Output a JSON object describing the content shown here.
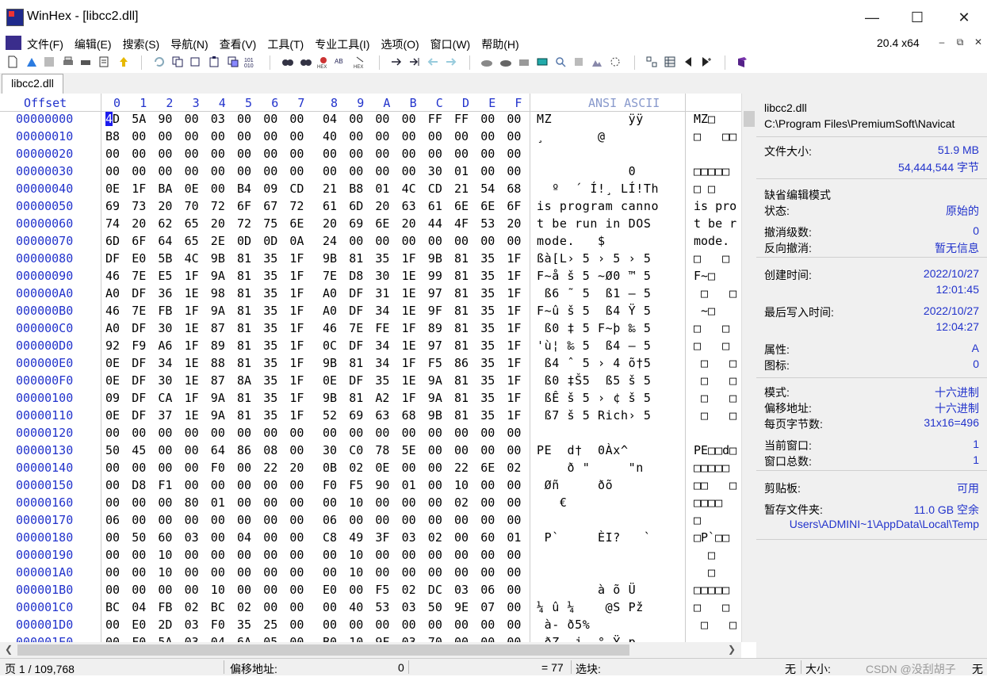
{
  "window": {
    "title": "WinHex - [libcc2.dll]",
    "minimize_icon": "minimize-icon",
    "maximize_icon": "maximize-icon",
    "close_icon": "close-icon"
  },
  "menu": {
    "items": [
      "文件(F)",
      "编辑(E)",
      "搜索(S)",
      "导航(N)",
      "查看(V)",
      "工具(T)",
      "专业工具(I)",
      "选项(O)",
      "窗口(W)",
      "帮助(H)"
    ],
    "version": "20.4 x64"
  },
  "tab": {
    "label": "libcc2.dll"
  },
  "hex": {
    "offset_header": "Offset",
    "col_headers": [
      "0",
      "1",
      "2",
      "3",
      "4",
      "5",
      "6",
      "7",
      "8",
      "9",
      "A",
      "B",
      "C",
      "D",
      "E",
      "F"
    ],
    "text_header": "ANSI ASCII",
    "rows": [
      {
        "off": "00000000",
        "bytes": [
          "4D",
          "5A",
          "90",
          "00",
          "03",
          "00",
          "00",
          "00",
          "04",
          "00",
          "00",
          "00",
          "FF",
          "FF",
          "00",
          "00"
        ],
        "ansi": "MZ          ÿÿ",
        "ascii": "MZ□"
      },
      {
        "off": "00000010",
        "bytes": [
          "B8",
          "00",
          "00",
          "00",
          "00",
          "00",
          "00",
          "00",
          "40",
          "00",
          "00",
          "00",
          "00",
          "00",
          "00",
          "00"
        ],
        "ansi": "¸       @",
        "ascii": "□   □□"
      },
      {
        "off": "00000020",
        "bytes": [
          "00",
          "00",
          "00",
          "00",
          "00",
          "00",
          "00",
          "00",
          "00",
          "00",
          "00",
          "00",
          "00",
          "00",
          "00",
          "00"
        ],
        "ansi": "",
        "ascii": ""
      },
      {
        "off": "00000030",
        "bytes": [
          "00",
          "00",
          "00",
          "00",
          "00",
          "00",
          "00",
          "00",
          "00",
          "00",
          "00",
          "00",
          "30",
          "01",
          "00",
          "00"
        ],
        "ansi": "            0",
        "ascii": "□□□□□"
      },
      {
        "off": "00000040",
        "bytes": [
          "0E",
          "1F",
          "BA",
          "0E",
          "00",
          "B4",
          "09",
          "CD",
          "21",
          "B8",
          "01",
          "4C",
          "CD",
          "21",
          "54",
          "68"
        ],
        "ansi": "  º  ´ Í!¸ LÍ!Th",
        "ascii": "□ □"
      },
      {
        "off": "00000050",
        "bytes": [
          "69",
          "73",
          "20",
          "70",
          "72",
          "6F",
          "67",
          "72",
          "61",
          "6D",
          "20",
          "63",
          "61",
          "6E",
          "6E",
          "6F"
        ],
        "ansi": "is program canno",
        "ascii": "is pro"
      },
      {
        "off": "00000060",
        "bytes": [
          "74",
          "20",
          "62",
          "65",
          "20",
          "72",
          "75",
          "6E",
          "20",
          "69",
          "6E",
          "20",
          "44",
          "4F",
          "53",
          "20"
        ],
        "ansi": "t be run in DOS ",
        "ascii": "t be r"
      },
      {
        "off": "00000070",
        "bytes": [
          "6D",
          "6F",
          "64",
          "65",
          "2E",
          "0D",
          "0D",
          "0A",
          "24",
          "00",
          "00",
          "00",
          "00",
          "00",
          "00",
          "00"
        ],
        "ansi": "mode.   $",
        "ascii": "mode."
      },
      {
        "off": "00000080",
        "bytes": [
          "DF",
          "E0",
          "5B",
          "4C",
          "9B",
          "81",
          "35",
          "1F",
          "9B",
          "81",
          "35",
          "1F",
          "9B",
          "81",
          "35",
          "1F"
        ],
        "ansi": "ßà[L› 5 › 5 › 5",
        "ascii": "□   □"
      },
      {
        "off": "00000090",
        "bytes": [
          "46",
          "7E",
          "E5",
          "1F",
          "9A",
          "81",
          "35",
          "1F",
          "7E",
          "D8",
          "30",
          "1E",
          "99",
          "81",
          "35",
          "1F"
        ],
        "ansi": "F~å š 5 ~Ø0 ™ 5",
        "ascii": "F~□"
      },
      {
        "off": "000000A0",
        "bytes": [
          "A0",
          "DF",
          "36",
          "1E",
          "98",
          "81",
          "35",
          "1F",
          "A0",
          "DF",
          "31",
          "1E",
          "97",
          "81",
          "35",
          "1F"
        ],
        "ansi": " ß6 ˜ 5  ß1 — 5",
        "ascii": " □   □"
      },
      {
        "off": "000000B0",
        "bytes": [
          "46",
          "7E",
          "FB",
          "1F",
          "9A",
          "81",
          "35",
          "1F",
          "A0",
          "DF",
          "34",
          "1E",
          "9F",
          "81",
          "35",
          "1F"
        ],
        "ansi": "F~û š 5  ß4 Ÿ 5",
        "ascii": " ~□"
      },
      {
        "off": "000000C0",
        "bytes": [
          "A0",
          "DF",
          "30",
          "1E",
          "87",
          "81",
          "35",
          "1F",
          "46",
          "7E",
          "FE",
          "1F",
          "89",
          "81",
          "35",
          "1F"
        ],
        "ansi": " ß0 ‡ 5 F~þ ‰ 5",
        "ascii": "□   □"
      },
      {
        "off": "000000D0",
        "bytes": [
          "92",
          "F9",
          "A6",
          "1F",
          "89",
          "81",
          "35",
          "1F",
          "0C",
          "DF",
          "34",
          "1E",
          "97",
          "81",
          "35",
          "1F"
        ],
        "ansi": "'ù¦ ‰ 5  ß4 — 5",
        "ascii": "□   □"
      },
      {
        "off": "000000E0",
        "bytes": [
          "0E",
          "DF",
          "34",
          "1E",
          "88",
          "81",
          "35",
          "1F",
          "9B",
          "81",
          "34",
          "1F",
          "F5",
          "86",
          "35",
          "1F"
        ],
        "ansi": " ß4 ˆ 5 › 4 õ†5",
        "ascii": " □   □"
      },
      {
        "off": "000000F0",
        "bytes": [
          "0E",
          "DF",
          "30",
          "1E",
          "87",
          "8A",
          "35",
          "1F",
          "0E",
          "DF",
          "35",
          "1E",
          "9A",
          "81",
          "35",
          "1F"
        ],
        "ansi": " ß0 ‡Š5  ß5 š 5",
        "ascii": " □   □"
      },
      {
        "off": "00000100",
        "bytes": [
          "09",
          "DF",
          "CA",
          "1F",
          "9A",
          "81",
          "35",
          "1F",
          "9B",
          "81",
          "A2",
          "1F",
          "9A",
          "81",
          "35",
          "1F"
        ],
        "ansi": " ßÊ š 5 › ¢ š 5",
        "ascii": " □   □"
      },
      {
        "off": "00000110",
        "bytes": [
          "0E",
          "DF",
          "37",
          "1E",
          "9A",
          "81",
          "35",
          "1F",
          "52",
          "69",
          "63",
          "68",
          "9B",
          "81",
          "35",
          "1F"
        ],
        "ansi": " ß7 š 5 Rich› 5",
        "ascii": " □   □"
      },
      {
        "off": "00000120",
        "bytes": [
          "00",
          "00",
          "00",
          "00",
          "00",
          "00",
          "00",
          "00",
          "00",
          "00",
          "00",
          "00",
          "00",
          "00",
          "00",
          "00"
        ],
        "ansi": "",
        "ascii": ""
      },
      {
        "off": "00000130",
        "bytes": [
          "50",
          "45",
          "00",
          "00",
          "64",
          "86",
          "08",
          "00",
          "30",
          "C0",
          "78",
          "5E",
          "00",
          "00",
          "00",
          "00"
        ],
        "ansi": "PE  d†  0Àx^",
        "ascii": "PE□□d□"
      },
      {
        "off": "00000140",
        "bytes": [
          "00",
          "00",
          "00",
          "00",
          "F0",
          "00",
          "22",
          "20",
          "0B",
          "02",
          "0E",
          "00",
          "00",
          "22",
          "6E",
          "02"
        ],
        "ansi": "    ð \"     \"n",
        "ascii": "□□□□□"
      },
      {
        "off": "00000150",
        "bytes": [
          "00",
          "D8",
          "F1",
          "00",
          "00",
          "00",
          "00",
          "00",
          "F0",
          "F5",
          "90",
          "01",
          "00",
          "10",
          "00",
          "00"
        ],
        "ansi": " Øñ     ðõ",
        "ascii": "□□   □"
      },
      {
        "off": "00000160",
        "bytes": [
          "00",
          "00",
          "00",
          "80",
          "01",
          "00",
          "00",
          "00",
          "00",
          "10",
          "00",
          "00",
          "00",
          "02",
          "00",
          "00"
        ],
        "ansi": "   €",
        "ascii": "□□□□"
      },
      {
        "off": "00000170",
        "bytes": [
          "06",
          "00",
          "00",
          "00",
          "00",
          "00",
          "00",
          "00",
          "06",
          "00",
          "00",
          "00",
          "00",
          "00",
          "00",
          "00"
        ],
        "ansi": "",
        "ascii": "□"
      },
      {
        "off": "00000180",
        "bytes": [
          "00",
          "50",
          "60",
          "03",
          "00",
          "04",
          "00",
          "00",
          "C8",
          "49",
          "3F",
          "03",
          "02",
          "00",
          "60",
          "01"
        ],
        "ansi": " P`     ÈI?   `",
        "ascii": "□P`□□"
      },
      {
        "off": "00000190",
        "bytes": [
          "00",
          "00",
          "10",
          "00",
          "00",
          "00",
          "00",
          "00",
          "00",
          "10",
          "00",
          "00",
          "00",
          "00",
          "00",
          "00"
        ],
        "ansi": "",
        "ascii": "  □"
      },
      {
        "off": "000001A0",
        "bytes": [
          "00",
          "00",
          "10",
          "00",
          "00",
          "00",
          "00",
          "00",
          "00",
          "10",
          "00",
          "00",
          "00",
          "00",
          "00",
          "00"
        ],
        "ansi": "",
        "ascii": "  □"
      },
      {
        "off": "000001B0",
        "bytes": [
          "00",
          "00",
          "00",
          "00",
          "10",
          "00",
          "00",
          "00",
          "E0",
          "00",
          "F5",
          "02",
          "DC",
          "03",
          "06",
          "00"
        ],
        "ansi": "        à õ Ü",
        "ascii": "□□□□□"
      },
      {
        "off": "000001C0",
        "bytes": [
          "BC",
          "04",
          "FB",
          "02",
          "BC",
          "02",
          "00",
          "00",
          "00",
          "40",
          "53",
          "03",
          "50",
          "9E",
          "07",
          "00"
        ],
        "ansi": "¼ û ¼    @S Pž",
        "ascii": "□   □"
      },
      {
        "off": "000001D0",
        "bytes": [
          "00",
          "E0",
          "2D",
          "03",
          "F0",
          "35",
          "25",
          "00",
          "00",
          "00",
          "00",
          "00",
          "00",
          "00",
          "00",
          "00"
        ],
        "ansi": " à- ð5%",
        "ascii": " □   □"
      },
      {
        "off": "000001E0",
        "bytes": [
          "00",
          "F0",
          "5A",
          "03",
          "04",
          "6A",
          "05",
          "00",
          "B0",
          "10",
          "9F",
          "03",
          "70",
          "00",
          "00",
          "00"
        ],
        "ansi": " ðZ  j  ° Ÿ p",
        "ascii": ""
      }
    ]
  },
  "info": {
    "filename": "libcc2.dll",
    "path": "C:\\Program Files\\PremiumSoft\\Navicat",
    "filesize_label": "文件大小:",
    "filesize_mb": "51.9 MB",
    "filesize_bytes": "54,444,544 字节",
    "default_edit_mode": "缺省编辑模式",
    "state_label": "状态:",
    "state_value": "原始的",
    "undo_level_label": "撤消级数:",
    "undo_level_value": "0",
    "reverse_undo_label": "反向撤消:",
    "reverse_undo_value": "暂无信息",
    "created_label": "创建时间:",
    "created_date": "2022/10/27",
    "created_time": "12:01:45",
    "modified_label": "最后写入时间:",
    "modified_date": "2022/10/27",
    "modified_time": "12:04:27",
    "attr_label": "属性:",
    "attr_value": "A",
    "icon_label": "图标:",
    "icon_value": "0",
    "mode_label": "模式:",
    "mode_value": "十六进制",
    "offset_label": "偏移地址:",
    "offset_value": "十六进制",
    "bytes_per_page_label": "每页字节数:",
    "bytes_per_page_value": "31x16=496",
    "current_window_label": "当前窗口:",
    "current_window_value": "1",
    "total_windows_label": "窗口总数:",
    "total_windows_value": "1",
    "clipboard_label": "剪贴板:",
    "clipboard_value": "可用",
    "temp_folder_label": "暂存文件夹:",
    "temp_folder_value": "11.0 GB 空余",
    "temp_path": "Users\\ADMINI~1\\AppData\\Local\\Temp"
  },
  "status": {
    "page": "页 1 / 109,768",
    "offset_label": "偏移地址:",
    "offset_value": "0",
    "eq_value": "= 77",
    "block_label": "选块:",
    "block_value": "无",
    "size_label": "大小:",
    "size_value": "无",
    "watermark": "CSDN @没刮胡子"
  }
}
